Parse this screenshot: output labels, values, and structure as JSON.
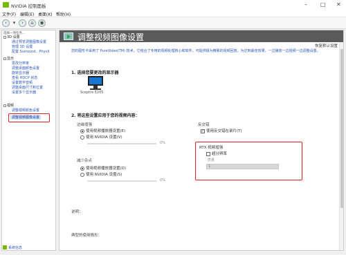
{
  "window": {
    "title": "NVIDIA 控制面板"
  },
  "menu": [
    "文件(F)",
    "编辑(E)",
    "桌面(K)",
    "帮助(H)"
  ],
  "sidebar": {
    "header": "选择一项任务...",
    "groups": [
      {
        "label": "3D 设置",
        "items": [
          "通过预览调整图像设置",
          "管理 3D 设置",
          "配置 Surround、PhysX"
        ]
      },
      {
        "label": "显示",
        "items": [
          "更改分辨率",
          "调整桌面颜色设置",
          "旋转显示器",
          "查看 HDCP 状态",
          "设置数字音频",
          "调整桌面尺寸和位置",
          "设置多个显示器"
        ]
      },
      {
        "label": "视频",
        "items": [
          "调整视频颜色设置",
          "调整视频图像设置"
        ]
      }
    ],
    "footer_link": "系统信息"
  },
  "main": {
    "title": "调整视频图像设置",
    "restore": "恢复默认设置",
    "description": "您的图形卡采用了 PureVideo(TM) 技术，它结合了专用的视频处理核心和软件，可提供极为精致的视频回放。为达到最佳效果，一边播放一边视频一边调整设置。",
    "step1": "1. 选择您要更改的显示器",
    "monitor_label": "Sceptre E205",
    "step2": "2. 将这些设置应用于您的视频内容：",
    "edge": {
      "label": "边缘增强",
      "opt1": "使用视频播放器设置(E)",
      "opt2": "使用 NVIDIA 设置(V)",
      "value": "0%"
    },
    "noise": {
      "label": "减少杂点",
      "opt1": "使用视频播放器设置(D)",
      "opt2": "使用 NVIDIA 设置(S)",
      "value": "0%"
    },
    "deinterlace": {
      "label": "反交错",
      "checkbox": "使用反交错在录片(T)",
      "checked": true
    },
    "rtx": {
      "title": "RTX 视频增强",
      "checkbox": "超分辨率",
      "checked": false,
      "quality_label": "质量",
      "quality_value": "1"
    },
    "footer": {
      "desc_label": "说明：",
      "usage_label": "典型的使用情形："
    }
  }
}
